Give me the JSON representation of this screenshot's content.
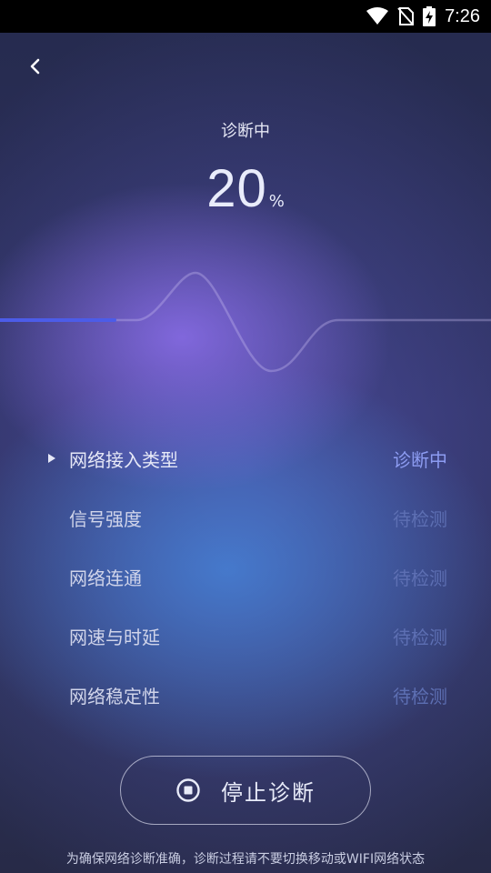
{
  "status_bar": {
    "time": "7:26",
    "icons": [
      "wifi-icon",
      "no-sim-icon",
      "battery-charging-icon"
    ]
  },
  "header": {
    "back_icon": "chevron-left-icon"
  },
  "progress": {
    "label": "诊断中",
    "value": "20",
    "unit": "%",
    "fraction": 0.2
  },
  "checks": [
    {
      "label": "网络接入类型",
      "status": "诊断中",
      "active": true
    },
    {
      "label": "信号强度",
      "status": "待检测",
      "active": false
    },
    {
      "label": "网络连通",
      "status": "待检测",
      "active": false
    },
    {
      "label": "网速与时延",
      "status": "待检测",
      "active": false
    },
    {
      "label": "网络稳定性",
      "status": "待检测",
      "active": false
    }
  ],
  "stop_button": {
    "label": "停止诊断",
    "icon": "stop-circle-icon"
  },
  "footer": {
    "note": "为确保网络诊断准确，诊断过程请不要切换移动或WIFI网络状态"
  },
  "colors": {
    "accent": "#8d9cf2",
    "progress_line": "#4c5ce8",
    "pending": "#5d6fb3"
  }
}
